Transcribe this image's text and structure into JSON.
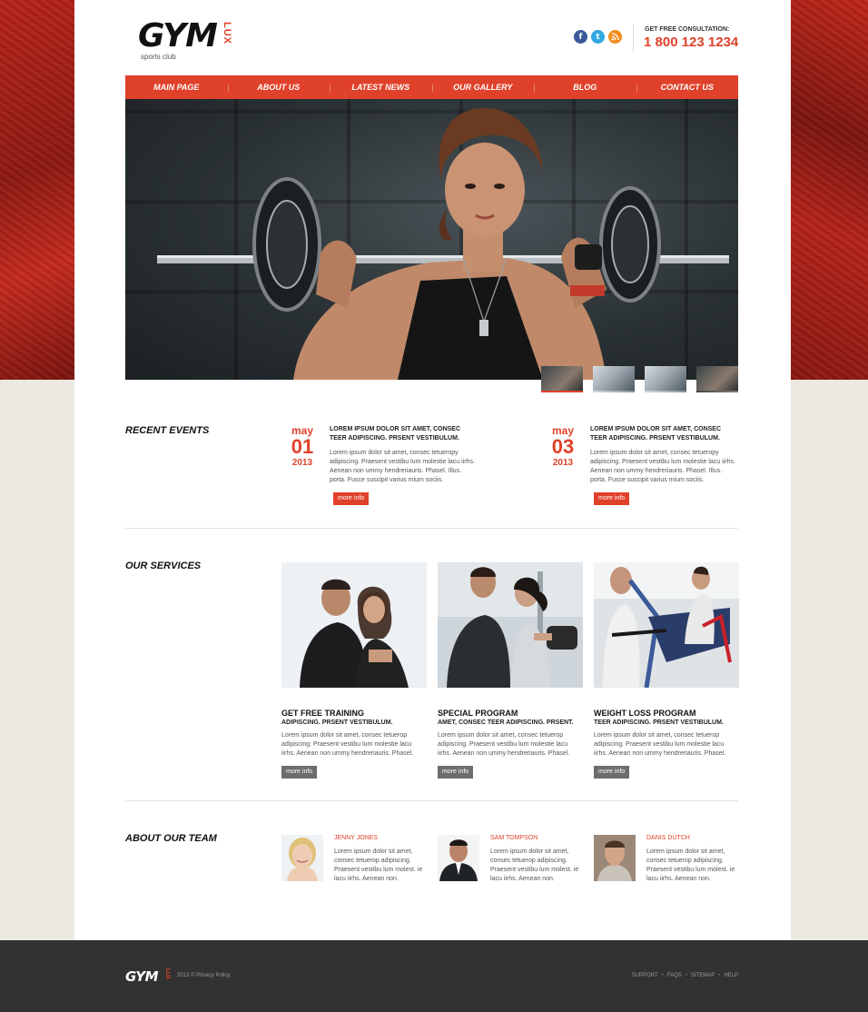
{
  "brand": {
    "name": "GYM",
    "tag": "LUX",
    "subtitle": "sports club"
  },
  "header": {
    "consult_label": "GET FREE CONSULTATION:",
    "phone": "1 800 123 1234",
    "social": [
      "facebook-icon",
      "twitter-icon",
      "rss-icon"
    ]
  },
  "nav": {
    "items": [
      {
        "label": "MAIN PAGE"
      },
      {
        "label": "ABOUT US"
      },
      {
        "label": "LATEST NEWS"
      },
      {
        "label": "OUR GALLERY"
      },
      {
        "label": "BLOG"
      },
      {
        "label": "CONTACT US"
      }
    ]
  },
  "slider": {
    "active_thumb": 0,
    "thumb_count": 4
  },
  "events": {
    "title": "RECENT EVENTS",
    "items": [
      {
        "month": "may",
        "day": "01",
        "year": "2013",
        "heading": "LOREM IPSUM DOLOR SIT AMET, CONSEC TEER ADIPISCING. PRSENT VESTIBULUM.",
        "text": "Lorem ipsum dolor sit amet, consec tetueropy adipiscing. Praesent vestibu lum molestie lacu iirhs. Aenean non ummy hendreriauris. Phasel. Illus. porta. Fusce suscipit varius mium sociis.",
        "button": "more info"
      },
      {
        "month": "may",
        "day": "03",
        "year": "2013",
        "heading": "LOREM IPSUM DOLOR SIT AMET, CONSEC TEER ADIPISCING. PRSENT VESTIBULUM.",
        "text": "Lorem ipsum dolor sit amet, consec tetueropy adipiscing. Praesent vestibu lum molestie lacu iirhs. Aenean non ummy hendreriauris. Phasel. Illus. porta. Fusce suscipit varius mium sociis.",
        "button": "more info"
      }
    ]
  },
  "services": {
    "title": "OUR SERVICES",
    "items": [
      {
        "title": "GET FREE TRAINING",
        "sub": "ADIPISCING. PRSENT VESTIBULUM.",
        "text": "Lorem ipsum dolor sit amet, consec tetuerop adipiscing. Praesent vestibu lum molestie lacu iirhs. Aenean non ummy hendreriauris. Phasel.",
        "button": "more info"
      },
      {
        "title": "SPECIAL PROGRAM",
        "sub": "AMET, CONSEC TEER ADIPISCING. PRSENT.",
        "text": "Lorem ipsum dolor sit amet, consec tetuerop adipiscing. Praesent vestibu lum molestie lacu iirhs. Aenean non ummy hendreriauris. Phasel.",
        "button": "more info"
      },
      {
        "title": "WEIGHT LOSS PROGRAM",
        "sub": "TEER ADIPISCING. PRSENT VESTIBULUM.",
        "text": "Lorem ipsum dolor sit amet, consec tetuerop adipiscing. Praesent vestibu lum molestie lacu iirhs. Aenean non ummy hendreriauris. Phasel.",
        "button": "more info"
      }
    ]
  },
  "team": {
    "title": "ABOUT OUR TEAM",
    "members": [
      {
        "name": "JENNY JONES",
        "text": "Lorem ipsum dolor sit amet, consec tetuerop adipiscing. Praesent vestibu lum molest. ie lacu iirhs. Aenean non."
      },
      {
        "name": "SAM TOMPSON",
        "text": "Lorem ipsum dolor sit amet, consec tetuerop adipiscing. Praesent vestibu lum molest. ie lacu iirhs. Aenean non."
      },
      {
        "name": "DANIS DUTCH",
        "text": "Lorem ipsum dolor sit amet, consec tetuerop adipiscing. Praesent vestibu lum molest. ie lacu iirhs. Aenean non."
      }
    ]
  },
  "footer": {
    "logo": "GYM",
    "tag": "LUX",
    "copyright": "2013 © Privacy Policy",
    "links": [
      "SUPPORT",
      "FAQS",
      "SITEMAP",
      "HELP"
    ]
  },
  "colors": {
    "accent": "#e0412a",
    "footer_bg": "#323232",
    "button_gray": "#6d6d6d"
  }
}
